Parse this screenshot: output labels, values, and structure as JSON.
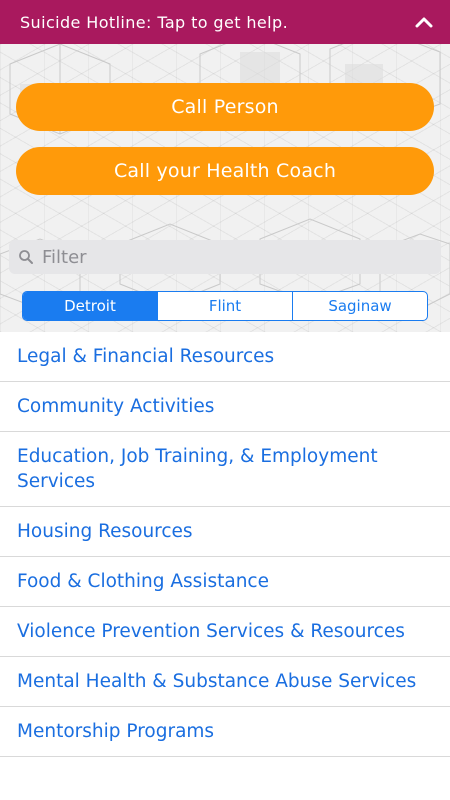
{
  "banner": {
    "text": "Suicide Hotline: Tap to get help.",
    "icon": "chevron-up-icon"
  },
  "actions": {
    "call_person": "Call Person",
    "call_coach": "Call your Health Coach"
  },
  "filter": {
    "placeholder": "Filter"
  },
  "segments": {
    "items": [
      "Detroit",
      "Flint",
      "Saginaw"
    ],
    "selected": "Detroit"
  },
  "resources": [
    "Legal & Financial Resources",
    "Community Activities",
    "Education, Job Training, & Employment Services",
    "Housing Resources",
    "Food & Clothing Assistance",
    "Violence Prevention Services & Resources",
    "Mental Health & Substance Abuse Services",
    "Mentorship Programs"
  ],
  "colors": {
    "banner": "#a9195e",
    "cta": "#ff9a0a",
    "link": "#1a6ee0",
    "segment": "#1a7cf0"
  }
}
